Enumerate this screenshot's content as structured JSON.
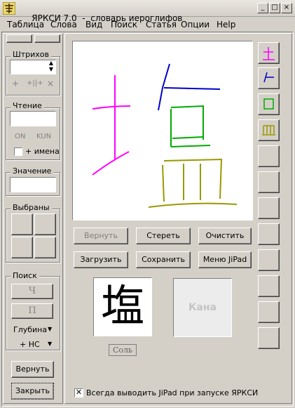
{
  "window": {
    "app_name": "ЯРКСИ 7.0",
    "separator": "-",
    "subtitle": "словарь иероглифов"
  },
  "menu": [
    "Таблица",
    "Слова",
    "Вид",
    "Поиск",
    "Статья",
    "Опции",
    "Help"
  ],
  "left_panel": {
    "strokes": {
      "title": "Штрихов",
      "value": "",
      "icons": [
        "+",
        "+||+",
        "×"
      ]
    },
    "reading": {
      "title": "Чтение",
      "value": "",
      "on_label": "ON",
      "kun_label": "KUN",
      "names_label": "+ имена",
      "names_checked": false
    },
    "meaning": {
      "title": "Значение",
      "value": ""
    },
    "selected": {
      "title": "Выбраны"
    },
    "search": {
      "title": "Поиск",
      "btn1": "Ч",
      "btn2": "П",
      "depth_label": "Глубина",
      "hc_label": "+ НС"
    },
    "back_button": "Вернуть",
    "close_button": "Закрыть"
  },
  "jipad": {
    "buttons": {
      "undo": "Вернуть",
      "erase": "Стереть",
      "clear": "Очистить",
      "load": "Загрузить",
      "save": "Сохранить",
      "menu": "Меню JiPad"
    },
    "result_kanji": "塩",
    "result_meaning": "Соль",
    "kana_placeholder": "Кана",
    "always_show_label": "Всегда выводить JiPad при запуске ЯРКСИ",
    "always_show_checked": true
  },
  "radical_colors": [
    "#ff00ff",
    "#0000cc",
    "#00aa00",
    "#999900"
  ]
}
